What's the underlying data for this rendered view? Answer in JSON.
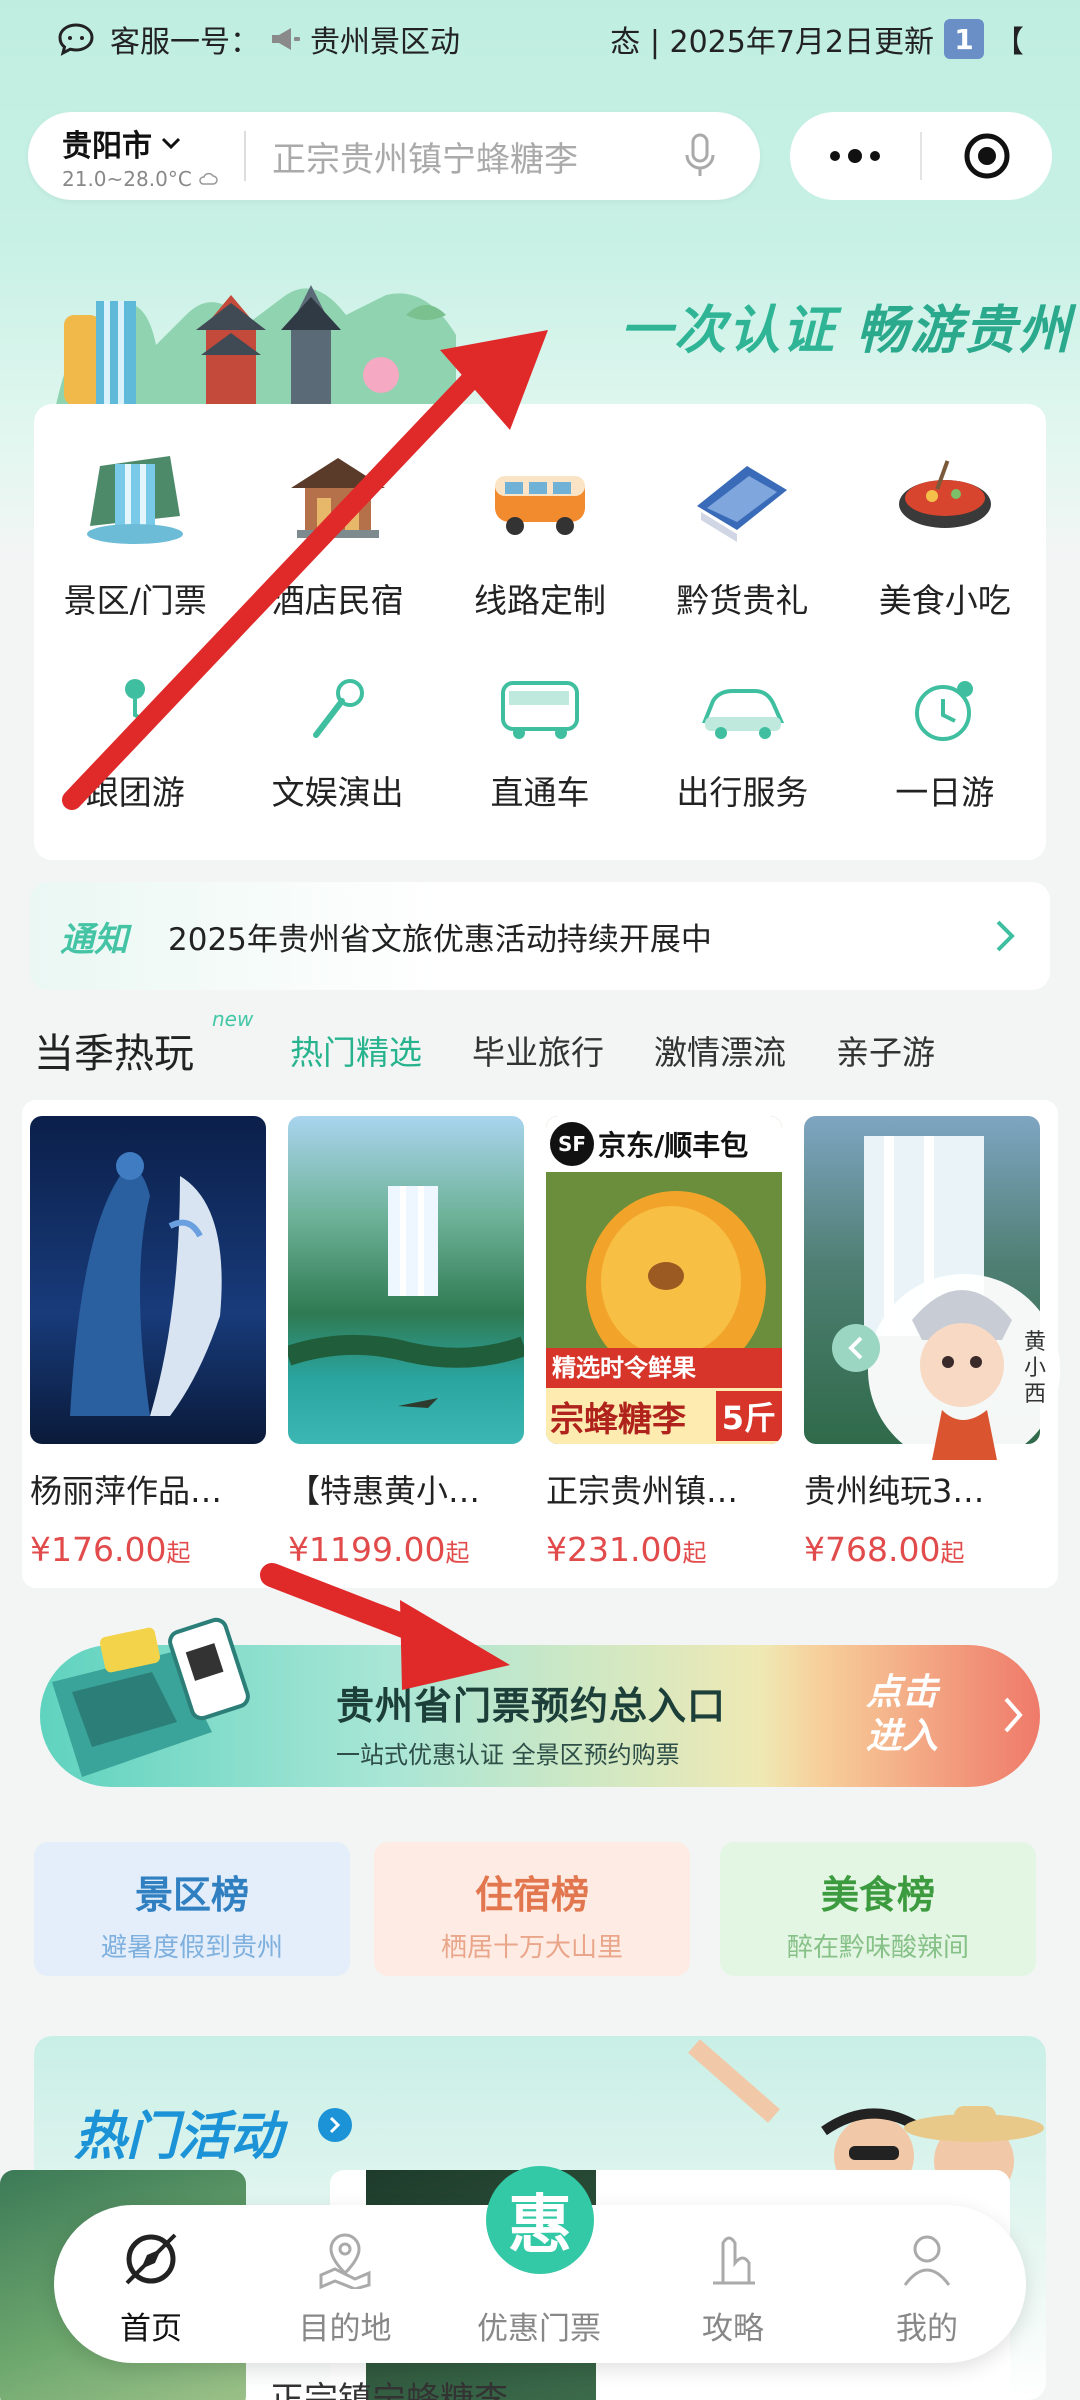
{
  "ticker": {
    "part1": "客服一号：",
    "part2": "贵州景区动",
    "part3": "态 | 2025年7月2日更新",
    "badge": "1",
    "tail": "【"
  },
  "location": {
    "city": "贵阳市",
    "temperature": "21.0~28.0°C"
  },
  "search": {
    "placeholder": "正宗贵州镇宁蜂糖李"
  },
  "banner": {
    "slogan_a": "一次认证",
    "slogan_b": "畅游贵州"
  },
  "categories_row1": [
    {
      "label": "景区/门票",
      "icon": "waterfall-icon"
    },
    {
      "label": "酒店民宿",
      "icon": "pavilion-icon"
    },
    {
      "label": "线路定制",
      "icon": "camper-van-icon"
    },
    {
      "label": "黔货贵礼",
      "icon": "gift-cloth-icon"
    },
    {
      "label": "美食小吃",
      "icon": "hotpot-icon"
    }
  ],
  "categories_row2": [
    {
      "label": "跟团游",
      "icon": "route-pin-icon"
    },
    {
      "label": "文娱演出",
      "icon": "microphone-icon"
    },
    {
      "label": "直通车",
      "icon": "bus-icon"
    },
    {
      "label": "出行服务",
      "icon": "car-icon"
    },
    {
      "label": "一日游",
      "icon": "clock-icon"
    }
  ],
  "notice": {
    "tag": "通知",
    "text": "2025年贵州省文旅优惠活动持续开展中"
  },
  "season": {
    "title": "当季热玩",
    "badge": "new",
    "tabs": [
      "热门精选",
      "毕业旅行",
      "激情漂流",
      "亲子游"
    ]
  },
  "products": [
    {
      "title": "杨丽萍作品…",
      "price": "¥176.00",
      "suffix": "起"
    },
    {
      "title": "【特惠黄小…",
      "price": "¥1199.00",
      "suffix": "起"
    },
    {
      "title": "正宗贵州镇…",
      "price": "¥231.00",
      "suffix": "起"
    },
    {
      "title": "贵州纯玩3…",
      "price": "¥768.00",
      "suffix": "起"
    }
  ],
  "product_overlays": {
    "jd_tag": "京东/顺丰包",
    "fruit_tag": "精选时令鲜果",
    "fruit_name": "宗蜂糖李",
    "fruit_qty": "5斤",
    "mascot_name": "黄小西"
  },
  "ticket_banner": {
    "title": "贵州省门票预约总入口",
    "subtitle": "一站式优惠认证 全景区预约购票",
    "enter_line1": "点击",
    "enter_line2": "进入"
  },
  "ranks": [
    {
      "title": "景区榜",
      "subtitle": "避暑度假到贵州",
      "color": "#2f7fc1",
      "bg": "#e3eefa",
      "subcolor": "#7fb0de"
    },
    {
      "title": "住宿榜",
      "subtitle": "栖居十万大山里",
      "color": "#e2774f",
      "bg": "#fdebe4",
      "subcolor": "#eaa68a"
    },
    {
      "title": "美食榜",
      "subtitle": "醉在黔味酸辣间",
      "color": "#3c9b3e",
      "bg": "#e3f5e3",
      "subcolor": "#86c187"
    }
  ],
  "hot": {
    "title": "热门活动",
    "card_text": "正宗镇宁蜂糖李"
  },
  "nav": {
    "items": [
      {
        "label": "首页",
        "icon": "home-compass-icon",
        "active": true
      },
      {
        "label": "目的地",
        "icon": "map-pin-icon",
        "active": false
      },
      {
        "label": "优惠门票",
        "icon": "discount-ticket-icon",
        "active": false
      },
      {
        "label": "攻略",
        "icon": "guide-icon",
        "active": false
      },
      {
        "label": "我的",
        "icon": "user-icon",
        "active": false
      }
    ],
    "center_glyph": "惠"
  },
  "colors": {
    "accent": "#28b38f",
    "price": "#e24b4b",
    "arrow": "#e02a2a"
  }
}
